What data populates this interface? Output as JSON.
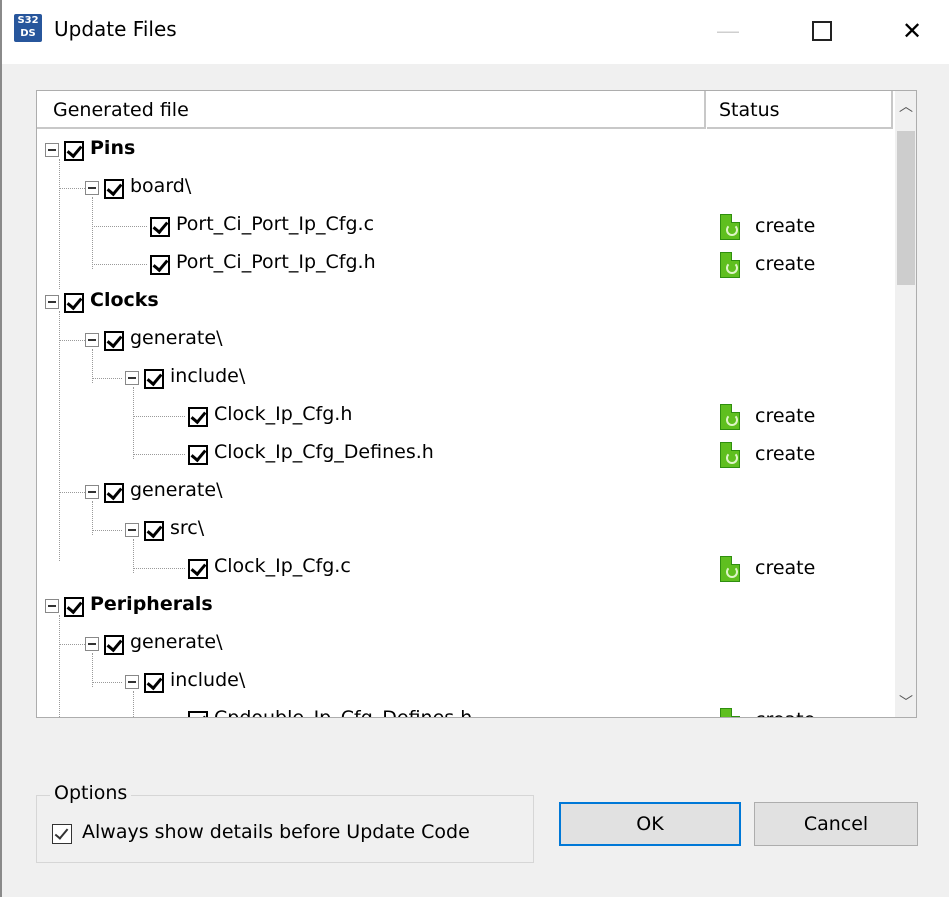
{
  "window": {
    "title": "Update Files",
    "icon_text_top": "S32",
    "icon_text_bottom": "DS",
    "minimize_glyph": "—",
    "close_glyph": "✕"
  },
  "table": {
    "columns": [
      "Generated file",
      "Status"
    ],
    "rows": [
      {
        "label": "Pins",
        "bold": true,
        "status": ""
      },
      {
        "label": "board\\",
        "bold": false,
        "status": ""
      },
      {
        "label": "Port_Ci_Port_Ip_Cfg.c",
        "bold": false,
        "status": "create"
      },
      {
        "label": "Port_Ci_Port_Ip_Cfg.h",
        "bold": false,
        "status": "create"
      },
      {
        "label": "Clocks",
        "bold": true,
        "status": ""
      },
      {
        "label": "generate\\",
        "bold": false,
        "status": ""
      },
      {
        "label": "include\\",
        "bold": false,
        "status": ""
      },
      {
        "label": "Clock_Ip_Cfg.h",
        "bold": false,
        "status": "create"
      },
      {
        "label": "Clock_Ip_Cfg_Defines.h",
        "bold": false,
        "status": "create"
      },
      {
        "label": "generate\\",
        "bold": false,
        "status": ""
      },
      {
        "label": "src\\",
        "bold": false,
        "status": ""
      },
      {
        "label": "Clock_Ip_Cfg.c",
        "bold": false,
        "status": "create"
      },
      {
        "label": "Peripherals",
        "bold": true,
        "status": ""
      },
      {
        "label": "generate\\",
        "bold": false,
        "status": ""
      },
      {
        "label": "include\\",
        "bold": false,
        "status": ""
      },
      {
        "label": "Cpdouble_Ip_Cfg_Defines.h",
        "bold": false,
        "status": "create"
      }
    ]
  },
  "scrollbar": {
    "up_glyph": "︿",
    "down_glyph": "﹀"
  },
  "options": {
    "title": "Options",
    "always_show_label": "Always show details before Update Code",
    "always_show_checked": true
  },
  "buttons": {
    "ok": "OK",
    "cancel": "Cancel"
  },
  "colors": {
    "accent": "#0078d7",
    "create_icon": "#5fbf1f",
    "app_icon": "#27569c"
  }
}
